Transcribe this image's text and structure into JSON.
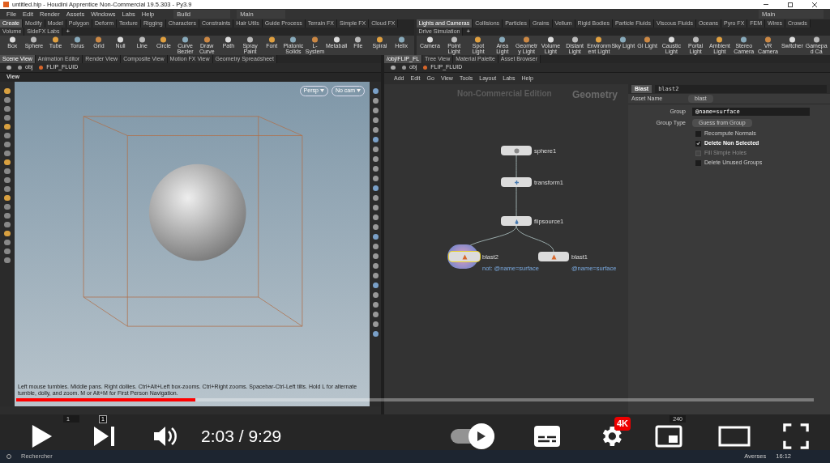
{
  "window": {
    "title": "untitled.hip - Houdini Apprentice Non-Commercial 19.5.303 - Py3.9"
  },
  "menu": [
    "File",
    "Edit",
    "Render",
    "Assets",
    "Windows",
    "Labs",
    "Help"
  ],
  "add_tab": "+",
  "desktop": "Build",
  "left_main": "Main",
  "right_main": "Main",
  "shelf_left": {
    "tabs": [
      {
        "label": "Create",
        "selected": true
      },
      {
        "label": "Modify",
        "selected": false
      },
      {
        "label": "Model",
        "selected": false
      },
      {
        "label": "Polygon",
        "selected": false
      },
      {
        "label": "Deform",
        "selected": false
      },
      {
        "label": "Texture",
        "selected": false
      },
      {
        "label": "Rigging",
        "selected": false
      },
      {
        "label": "Characters",
        "selected": false
      },
      {
        "label": "Constraints",
        "selected": false
      },
      {
        "label": "Hair Utils",
        "selected": false
      },
      {
        "label": "Guide Process",
        "selected": false
      },
      {
        "label": "Terrain FX",
        "selected": false
      },
      {
        "label": "Simple FX",
        "selected": false
      },
      {
        "label": "Cloud FX",
        "selected": false
      },
      {
        "label": "Volume",
        "selected": false
      },
      {
        "label": "SideFX Labs",
        "selected": false
      }
    ],
    "tools": [
      "Box",
      "Sphere",
      "Tube",
      "Torus",
      "Grid",
      "Null",
      "Line",
      "Circle",
      "Curve Bezier",
      "Draw Curve",
      "Path",
      "Spray Paint",
      "Font",
      "Platonic Solids",
      "L-System",
      "Metaball",
      "File",
      "Spiral",
      "Helix"
    ]
  },
  "shelf_right": {
    "tabs": [
      {
        "label": "Lights and Cameras",
        "selected": true
      },
      {
        "label": "Collisions",
        "selected": false
      },
      {
        "label": "Particles",
        "selected": false
      },
      {
        "label": "Grains",
        "selected": false
      },
      {
        "label": "Vellum",
        "selected": false
      },
      {
        "label": "Rigid Bodies",
        "selected": false
      },
      {
        "label": "Particle Fluids",
        "selected": false
      },
      {
        "label": "Viscous Fluids",
        "selected": false
      },
      {
        "label": "Oceans",
        "selected": false
      },
      {
        "label": "Pyro FX",
        "selected": false
      },
      {
        "label": "FEM",
        "selected": false
      },
      {
        "label": "Wires",
        "selected": false
      },
      {
        "label": "Crowds",
        "selected": false
      },
      {
        "label": "Drive Simulation",
        "selected": false
      }
    ],
    "tools": [
      "Camera",
      "Point Light",
      "Spot Light",
      "Area Light",
      "Geometry Light",
      "Volume Light",
      "Distant Light",
      "Environment Light",
      "Sky Light",
      "GI Light",
      "Caustic Light",
      "Portal Light",
      "Ambient Light",
      "Stereo Camera",
      "VR Camera",
      "Switcher",
      "Gamepad Ca"
    ]
  },
  "left_pane": {
    "tabs": [
      {
        "label": "Scene View",
        "selected": true
      },
      {
        "label": "Animation Editor",
        "selected": false
      },
      {
        "label": "Render View",
        "selected": false
      },
      {
        "label": "Composite View",
        "selected": false
      },
      {
        "label": "Motion FX View",
        "selected": false
      },
      {
        "label": "Geometry Spreadsheet",
        "selected": false
      }
    ],
    "path": [
      "obj",
      "FLIP_FLUID"
    ],
    "view_label": "View",
    "camera_menus": [
      "Persp",
      "No cam"
    ],
    "status": "Left mouse tumbles. Middle pans. Right dollies. Ctrl+Alt+Left box-zooms. Ctrl+Right zooms. Spacebar-Ctrl-Left tilts. Hold L for alternate tumble, dolly, and zoom. M or Alt+M for First Person Navigation."
  },
  "right_pane": {
    "tabs": [
      {
        "label": "/obj/FLIP_FL",
        "selected": true
      },
      {
        "label": "Tree View",
        "selected": false
      },
      {
        "label": "Material Palette",
        "selected": false
      },
      {
        "label": "Asset Browser",
        "selected": false
      }
    ],
    "path": [
      "obj",
      "FLIP_FLUID"
    ],
    "menu": [
      "Add",
      "Edit",
      "Go",
      "View",
      "Tools",
      "Layout",
      "Labs",
      "Help"
    ],
    "watermark_edition": "Non-Commercial Edition",
    "context": "Geometry",
    "nodes": [
      {
        "name": "sphere1",
        "kind": "sphere",
        "selected": false
      },
      {
        "name": "transform1",
        "kind": "transform",
        "selected": false
      },
      {
        "name": "flipsource1",
        "kind": "source",
        "selected": false
      },
      {
        "name": "blast2",
        "kind": "blast",
        "selected": true,
        "comment": "not: @name=surface"
      },
      {
        "name": "blast1",
        "kind": "blast",
        "selected": false,
        "comment": "@name=surface"
      }
    ]
  },
  "params": {
    "type": "Blast",
    "node": "blast2",
    "asset_label": "Asset Name",
    "asset": "blast",
    "group_label": "Group",
    "group": "@name=surface",
    "group_type_label": "Group Type",
    "group_type": "Guess from Group",
    "toggles": [
      {
        "label": "Recompute Normals",
        "checked": false,
        "disabled": false
      },
      {
        "label": "Delete Non Selected",
        "checked": true,
        "disabled": false
      },
      {
        "label": "Fill Simple Holes",
        "checked": false,
        "disabled": true
      },
      {
        "label": "Delete Unused Groups",
        "checked": false,
        "disabled": false
      }
    ]
  },
  "timeline": {
    "frame": "1",
    "marker": "1",
    "end": "240"
  },
  "player": {
    "progress": {
      "level": 0.225
    },
    "time": "2:03 / 9:29",
    "quality": "4K",
    "autoplay": {
      "on": true
    }
  },
  "taskbar": {
    "search": "Rechercher",
    "weather": "Averses",
    "clock": "16:12"
  }
}
